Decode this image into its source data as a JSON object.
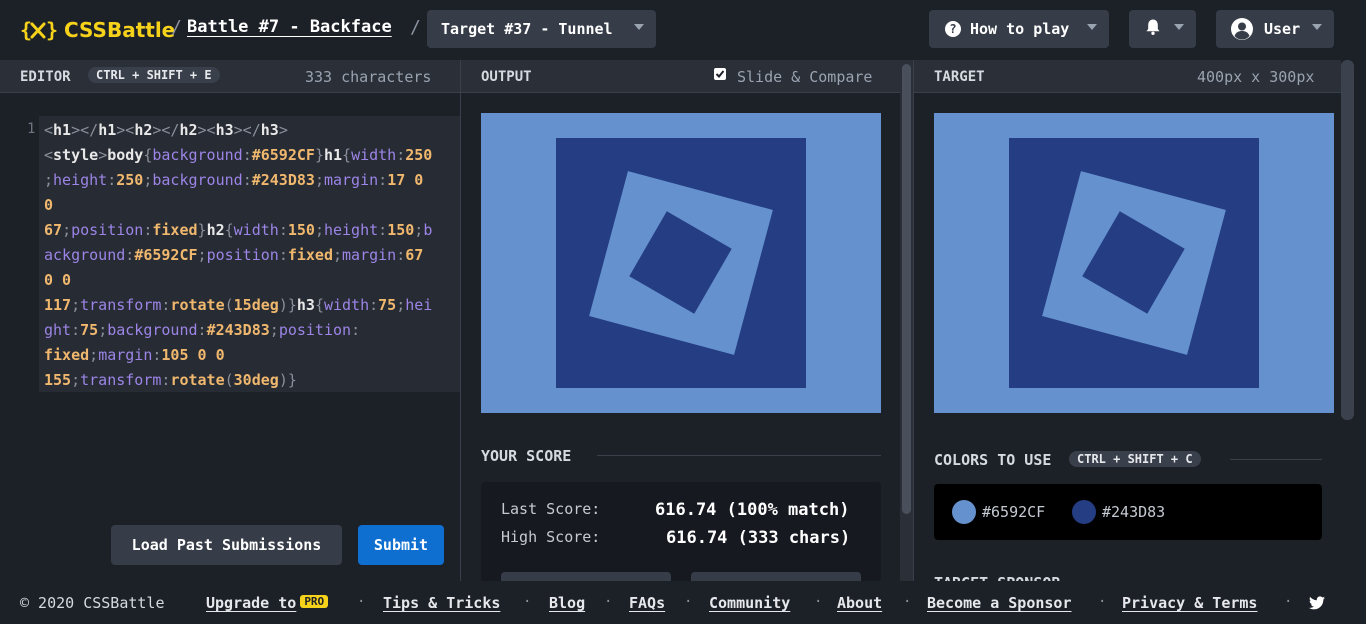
{
  "header": {
    "logo_text": "CSSBattle",
    "battle_link": "Battle #7 - Backface",
    "target_select": "Target #37 - Tunnel",
    "how_to_play": "How to play",
    "user": "User"
  },
  "editor": {
    "title": "EDITOR",
    "shortcut": "CTRL + SHIFT + E",
    "char_count": "333 characters",
    "line_number": "1",
    "load_past": "Load Past Submissions",
    "submit": "Submit"
  },
  "output": {
    "title": "OUTPUT",
    "slide_compare": "Slide & Compare",
    "slide_compare_checked": true
  },
  "target": {
    "title": "TARGET",
    "size": "400px x 300px"
  },
  "score": {
    "title": "YOUR SCORE",
    "last_label": "Last Score:",
    "last_value": "616.74 (100% match)",
    "high_label": "High Score:",
    "high_value": "616.74 (333 chars)"
  },
  "colors": {
    "title": "COLORS TO USE",
    "shortcut": "CTRL + SHIFT + C",
    "items": [
      {
        "hex": "#6592CF",
        "color": "#6592CF"
      },
      {
        "hex": "#243D83",
        "color": "#243D83"
      }
    ]
  },
  "target_sponsor_title": "TARGET SPONSOR",
  "footer": {
    "copyright": "© 2020 CSSBattle",
    "upgrade": "Upgrade to",
    "pro": "PRO",
    "tips": "Tips & Tricks",
    "blog": "Blog",
    "faqs": "FAQs",
    "community": "Community",
    "about": "About",
    "sponsor": "Become a Sponsor",
    "privacy": "Privacy & Terms"
  },
  "icons": [
    "logo-icon",
    "question-icon",
    "bell-icon",
    "user-icon",
    "checkbox-icon",
    "twitter-icon"
  ]
}
